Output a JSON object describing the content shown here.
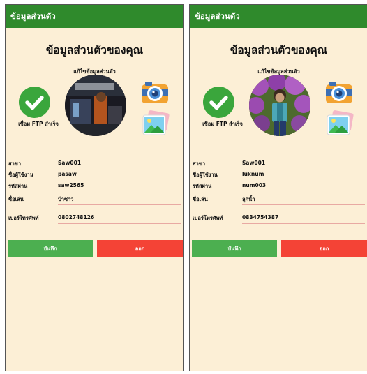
{
  "colors": {
    "app_bar": "#2f8a2c",
    "background": "#fcefd6",
    "save_button": "#4caf50",
    "logout_button": "#f44336",
    "input_underline": "#e8a9a3"
  },
  "screens": [
    {
      "app_bar_title": "ข้อมูลส่วนตัว",
      "page_title": "ข้อมูลส่วนตัวของคุณ",
      "edit_label": "แก้ไขข้อมูลส่วนตัว",
      "ftp_status": "เชื่อม FTP สำเร็จ",
      "fields": {
        "branch_label": "สาขา",
        "branch_value": "Saw001",
        "username_label": "ชื่อผู้ใช้งาน",
        "username_value": "pasaw",
        "password_label": "รหัสผ่าน",
        "password_value": "saw2565",
        "nickname_label": "ชื่อเล่น",
        "nickname_value": "ป้าซาว",
        "phone_label": "เบอร์โทรศัพท์",
        "phone_value": "0802748126"
      },
      "save_label": "บันทึก",
      "logout_label": "ออก",
      "icons": [
        "check-icon",
        "camera-icon",
        "gallery-icon"
      ]
    },
    {
      "app_bar_title": "ข้อมูลส่วนตัว",
      "page_title": "ข้อมูลส่วนตัวของคุณ",
      "edit_label": "แก้ไขข้อมูลส่วนตัว",
      "ftp_status": "เชื่อม FTP สำเร็จ",
      "fields": {
        "branch_label": "สาขา",
        "branch_value": "Saw001",
        "username_label": "ชื่อผู้ใช้งาน",
        "username_value": "luknum",
        "password_label": "รหัสผ่าน",
        "password_value": "num003",
        "nickname_label": "ชื่อเล่น",
        "nickname_value": "ลูกน้ำ",
        "phone_label": "เบอร์โทรศัพท์",
        "phone_value": "0834754387"
      },
      "save_label": "บันทึก",
      "logout_label": "ออก",
      "icons": [
        "check-icon",
        "camera-icon",
        "gallery-icon"
      ]
    }
  ]
}
